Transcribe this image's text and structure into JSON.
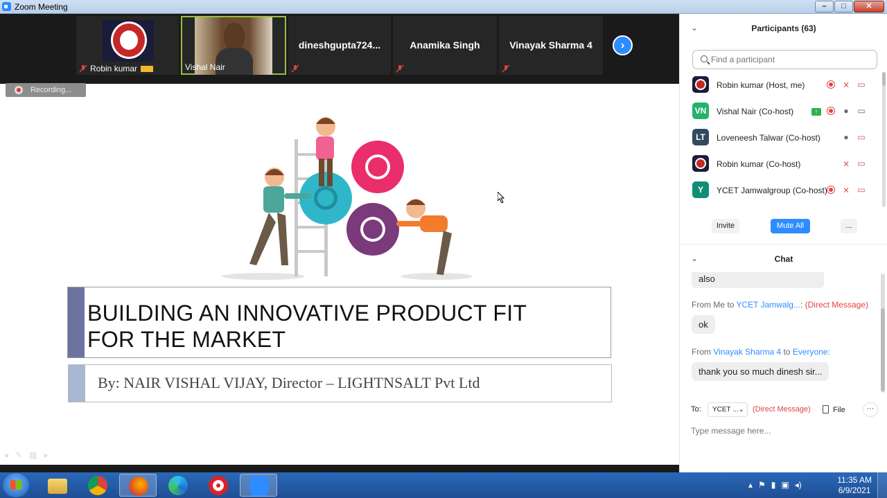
{
  "window": {
    "title": "Zoom Meeting",
    "minimize": "–",
    "maximize": "□",
    "close": "✕"
  },
  "videos": [
    {
      "name": "Robin kumar",
      "kind": "logo"
    },
    {
      "name": "Vishal Nair",
      "kind": "camera"
    },
    {
      "name": "dineshgupta724...",
      "kind": "text"
    },
    {
      "name": "Anamika Singh",
      "kind": "text"
    },
    {
      "name": "Vinayak Sharma 4",
      "kind": "text"
    }
  ],
  "next_page": "›",
  "recording_label": "Recording...",
  "slide": {
    "title_line1": "BUILDING AN INNOVATIVE PRODUCT FIT",
    "title_line2": "FOR THE MARKET",
    "byline": "By: NAIR VISHAL VIJAY, Director – LIGHTNSALT Pvt Ltd"
  },
  "participants_panel": {
    "header": "Participants (63)",
    "search_placeholder": "Find a participant",
    "items": [
      {
        "avatar_text": "",
        "avatar_color": "#1b1b3a",
        "name": "Robin kumar (Host, me)"
      },
      {
        "avatar_text": "VN",
        "avatar_color": "#23b26d",
        "name": "Vishal Nair (Co-host)"
      },
      {
        "avatar_text": "LT",
        "avatar_color": "#324a5f",
        "name": "Loveneesh Talwar (Co-host)"
      },
      {
        "avatar_text": "",
        "avatar_color": "#1b1b3a",
        "name": "Robin kumar (Co-host)"
      },
      {
        "avatar_text": "Y",
        "avatar_color": "#0f8f76",
        "name": "YCET Jamwalgroup (Co-host)"
      }
    ],
    "invite": "Invite",
    "mute_all": "Mute All",
    "more": "..."
  },
  "chat": {
    "header": "Chat",
    "messages": [
      {
        "text": "also"
      },
      {
        "from_prefix": "From Me to ",
        "from_name": "YCET Jamwalg...",
        "from_suffix": ": ",
        "dm": "(Direct Message)",
        "text": "ok"
      },
      {
        "from_prefix": "From ",
        "from_name": "Vinayak Sharma 4",
        "from_to": " to ",
        "to_name": "Everyone:",
        "text": "thank you so much dinesh sir..."
      }
    ],
    "to_label": "To:",
    "to_value": "YCET ...",
    "to_dm": "(Direct Message)",
    "file_label": "File",
    "more": "···",
    "input_placeholder": "Type message here..."
  },
  "taskbar": {
    "apps": [
      "file-explorer",
      "chrome",
      "firefox",
      "edge",
      "opera",
      "zoom"
    ],
    "time": "11:35 AM",
    "date": "6/9/2021"
  }
}
